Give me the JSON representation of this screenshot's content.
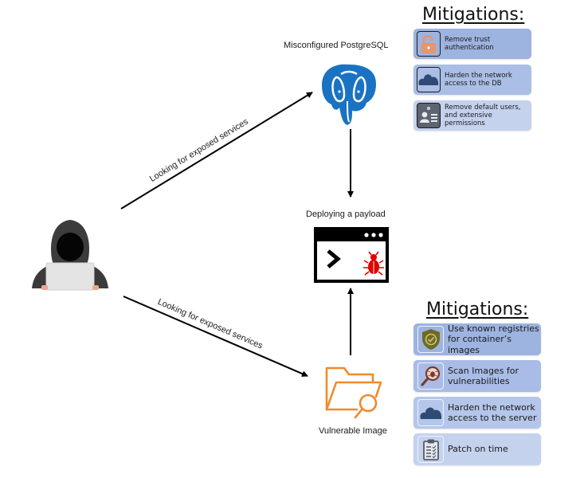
{
  "diagram": {
    "attacker": {
      "icon": "hooded-hacker-icon"
    },
    "edges": {
      "to_postgres_label": "Looking for exposed services",
      "to_image_label": "Looking for exposed services"
    },
    "nodes": {
      "postgres": {
        "label": "Misconfigured PostgreSQL",
        "icon": "postgresql-elephant-icon",
        "color": "#336791"
      },
      "payload": {
        "label": "Deploying a payload",
        "icon": "terminal-bug-icon",
        "bug_color": "#e00000"
      },
      "image": {
        "label": "Vulnerable Image",
        "icon": "folder-search-icon",
        "color": "#f08a2c"
      }
    },
    "mitigations_top": {
      "title": "Mitigations:",
      "items": [
        {
          "label_lines": [
            "Remove trust",
            "authentication"
          ],
          "icon": "unlocked-padlock-icon",
          "bg": "#9db3e0"
        },
        {
          "label_lines": [
            "Harden the network",
            "access to the DB"
          ],
          "icon": "cloud-icon",
          "bg": "#aabee6"
        },
        {
          "label_lines": [
            "Remove default users,",
            "and extensive",
            "permissions"
          ],
          "icon": "id-badge-icon",
          "bg": "#c4d2ee"
        }
      ]
    },
    "mitigations_bottom": {
      "title": "Mitigations:",
      "items": [
        {
          "label_lines": [
            "Use known registries",
            "for container’s images"
          ],
          "icon": "shield-check-icon",
          "bg": "#9db3e0"
        },
        {
          "label_lines": [
            "Scan Images for",
            "vulnerabilities"
          ],
          "icon": "magnifier-bug-icon",
          "bg": "#a8bce6"
        },
        {
          "label_lines": [
            "Harden the network",
            "access to the server"
          ],
          "icon": "cloud-icon",
          "bg": "#b4c6ea"
        },
        {
          "label_lines": [
            "Patch on time"
          ],
          "icon": "clipboard-checklist-icon",
          "bg": "#c4d2ee"
        }
      ]
    }
  }
}
